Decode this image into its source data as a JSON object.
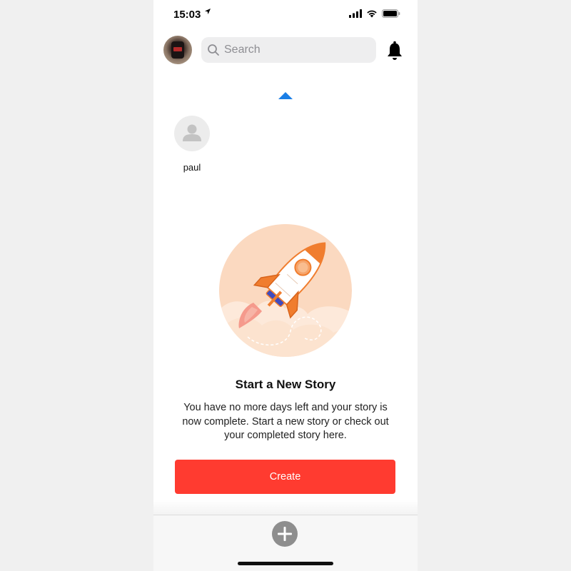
{
  "status_bar": {
    "time": "15:03"
  },
  "header": {
    "search_placeholder": "Search"
  },
  "friends": [
    {
      "name": "paul"
    }
  ],
  "empty_state": {
    "title": "Start a New Story",
    "description": "You have no more days left and your story is now complete. Start a new story or check out your completed story here.",
    "button_label": "Create"
  },
  "colors": {
    "accent": "#ff3b30",
    "caret": "#1a7ee6",
    "illustration_bg": "#fbd9c0",
    "rocket_orange": "#f07d2e"
  },
  "icons": {
    "location": "location-arrow-icon",
    "signal": "cellular-signal-icon",
    "wifi": "wifi-icon",
    "battery": "battery-icon",
    "search": "search-icon",
    "bell": "bell-icon",
    "caret": "caret-up-icon",
    "add": "plus-circle-icon"
  }
}
